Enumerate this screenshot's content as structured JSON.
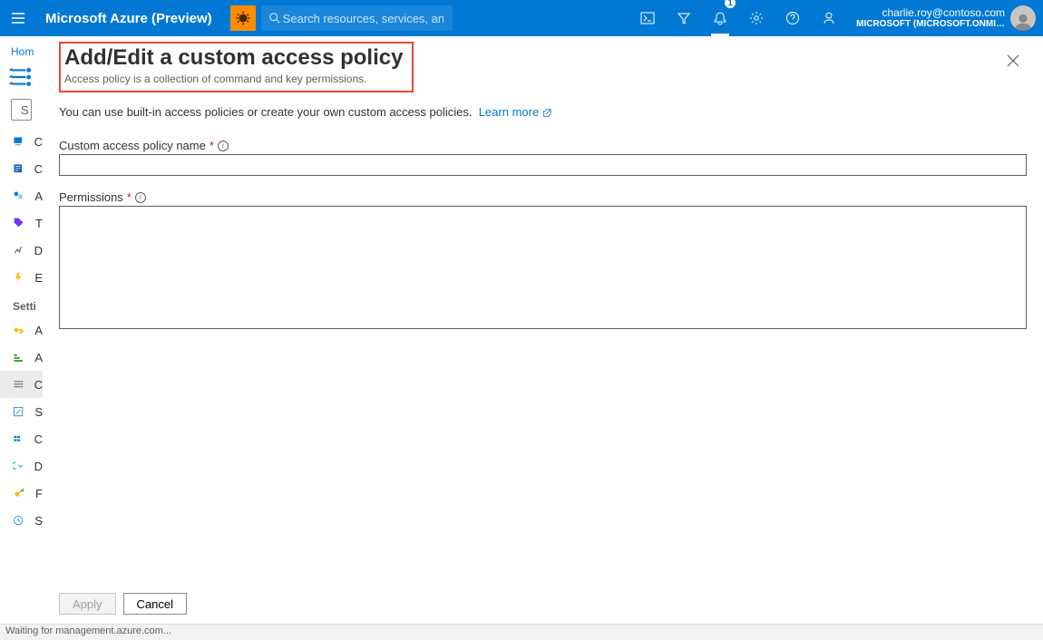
{
  "topbar": {
    "brand": "Microsoft Azure (Preview)",
    "search_placeholder": "Search resources, services, and docs (G+/)",
    "notification_count": "1",
    "account_email": "charlie.roy@contoso.com",
    "account_org": "MICROSOFT (MICROSOFT.ONMI…"
  },
  "breadcrumb": "Hom",
  "sidebar": {
    "search_placeholder": "S",
    "header_settings": "Setti",
    "items_top": [
      {
        "label": "C"
      },
      {
        "label": "C"
      },
      {
        "label": "A"
      },
      {
        "label": "T"
      },
      {
        "label": "D"
      },
      {
        "label": "E"
      }
    ],
    "items_settings": [
      {
        "label": "A"
      },
      {
        "label": "A"
      },
      {
        "label": "C",
        "selected": true
      },
      {
        "label": "S"
      },
      {
        "label": "C"
      },
      {
        "label": "D"
      },
      {
        "label": "F"
      },
      {
        "label": "S"
      }
    ]
  },
  "blade": {
    "title": "Add/Edit a custom access policy",
    "subtitle": "Access policy is a collection of command and key permissions.",
    "info_text": "You can use built-in access policies or create your own custom access policies.",
    "learn_more": "Learn more",
    "field_name_label": "Custom access policy name",
    "field_name_value": "",
    "field_perm_label": "Permissions",
    "field_perm_value": "",
    "apply": "Apply",
    "cancel": "Cancel"
  },
  "statusbar": "Waiting for management.azure.com..."
}
